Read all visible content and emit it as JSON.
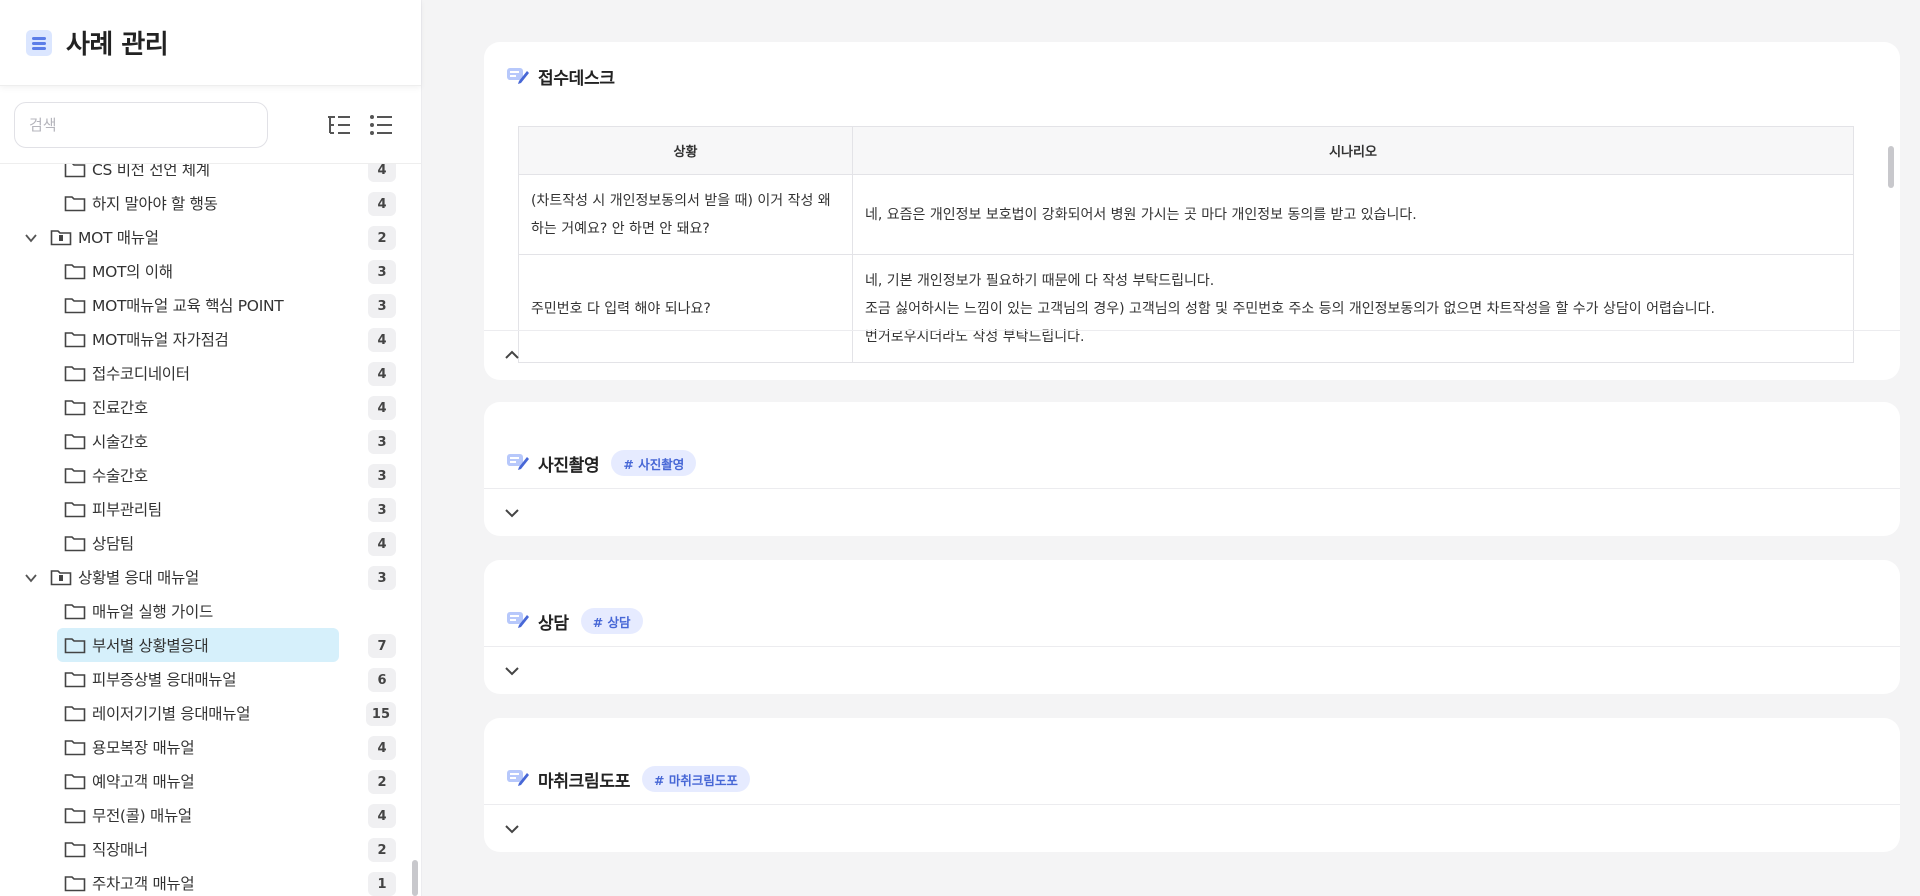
{
  "app": {
    "title": "사례 관리"
  },
  "search": {
    "placeholder": "검색"
  },
  "tree": [
    {
      "label": "CS 비전 선언 체계",
      "count": "4",
      "level": 1,
      "type": "folder"
    },
    {
      "label": "하지 말아야 할 행동",
      "count": "4",
      "level": 1,
      "type": "folder"
    },
    {
      "label": "MOT 매뉴얼",
      "count": "2",
      "level": 0,
      "type": "book",
      "expanded": true
    },
    {
      "label": "MOT의 이해",
      "count": "3",
      "level": 1,
      "type": "folder"
    },
    {
      "label": "MOT매뉴얼 교육 핵심 POINT",
      "count": "3",
      "level": 1,
      "type": "folder"
    },
    {
      "label": "MOT매뉴얼 자가점검",
      "count": "4",
      "level": 1,
      "type": "folder"
    },
    {
      "label": "접수코디네이터",
      "count": "4",
      "level": 1,
      "type": "folder"
    },
    {
      "label": "진료간호",
      "count": "4",
      "level": 1,
      "type": "folder"
    },
    {
      "label": "시술간호",
      "count": "3",
      "level": 1,
      "type": "folder"
    },
    {
      "label": "수술간호",
      "count": "3",
      "level": 1,
      "type": "folder"
    },
    {
      "label": "피부관리팀",
      "count": "3",
      "level": 1,
      "type": "folder"
    },
    {
      "label": "상담팀",
      "count": "4",
      "level": 1,
      "type": "folder"
    },
    {
      "label": "상황별 응대 매뉴얼",
      "count": "3",
      "level": 0,
      "type": "book",
      "expanded": true
    },
    {
      "label": "매뉴얼 실행 가이드",
      "count": "",
      "level": 1,
      "type": "folder"
    },
    {
      "label": "부서별 상황별응대",
      "count": "7",
      "level": 1,
      "type": "folder",
      "selected": true
    },
    {
      "label": "피부증상별 응대매뉴얼",
      "count": "6",
      "level": 1,
      "type": "folder"
    },
    {
      "label": "레이저기기별 응대매뉴얼",
      "count": "15",
      "level": 1,
      "type": "folder"
    },
    {
      "label": "용모복장 매뉴얼",
      "count": "4",
      "level": 1,
      "type": "folder"
    },
    {
      "label": "예약고객 매뉴얼",
      "count": "2",
      "level": 1,
      "type": "folder"
    },
    {
      "label": "무전(콜) 매뉴얼",
      "count": "4",
      "level": 1,
      "type": "folder"
    },
    {
      "label": "직장매너",
      "count": "2",
      "level": 1,
      "type": "folder"
    },
    {
      "label": "주차고객 매뉴얼",
      "count": "1",
      "level": 1,
      "type": "folder"
    }
  ],
  "cards": {
    "reception": {
      "title": "접수데스크",
      "table": {
        "headers": [
          "상황",
          "시나리오"
        ],
        "rows": [
          {
            "situation": "(차트작성 시 개인정보동의서 받을 때) 이거 작성 왜 하는 거예요? 안 하면 안 돼요?",
            "scenario": [
              "네, 요즘은 개인정보 보호법이 강화되어서 병원 가시는 곳 마다 개인정보 동의를 받고 있습니다."
            ]
          },
          {
            "situation": "주민번호 다 입력 해야 되나요?",
            "scenario": [
              "네, 기본 개인정보가 필요하기 때문에 다 작성 부탁드립니다.",
              "조금 싫어하시는 느낌이 있는 고객님의 경우) 고객님의 성함 및 주민번호 주소 등의 개인정보동의가 없으면 차트작성을 할 수가 상담이 어렵습니다.",
              "번거로우시더라도 작성 부탁드립니다."
            ]
          }
        ]
      }
    },
    "photo": {
      "title": "사진촬영",
      "tag": "# 사진촬영"
    },
    "consult": {
      "title": "상담",
      "tag": "# 상담"
    },
    "anesthesia": {
      "title": "마취크림도포",
      "tag": "# 마취크림도포"
    }
  },
  "colors": {
    "accent": "#5b7de8",
    "selected_bg": "#d6f0fb",
    "tag_bg": "#e6ebff",
    "tag_text": "#4767d6"
  }
}
